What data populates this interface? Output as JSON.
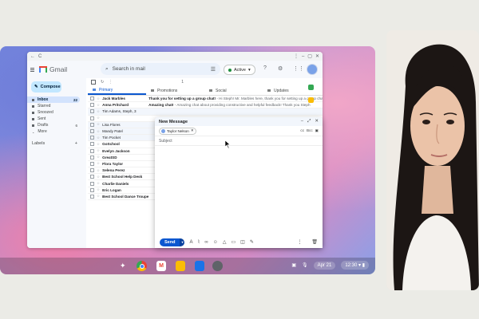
{
  "browser": {
    "nav_back": "←",
    "nav_reload": "C",
    "menu": "⋮"
  },
  "gmail": {
    "logo_text": "Gmail",
    "search_placeholder": "Search in mail",
    "status": "Active",
    "compose_label": "Compose",
    "nav": [
      {
        "label": "Inbox",
        "count": "22"
      },
      {
        "label": "Starred",
        "count": ""
      },
      {
        "label": "Snoozed",
        "count": ""
      },
      {
        "label": "Sent",
        "count": ""
      },
      {
        "label": "Drafts",
        "count": "6"
      },
      {
        "label": "More",
        "count": ""
      }
    ],
    "labels_heading": "Labels",
    "tabs": [
      "Primary",
      "Promotions",
      "Social",
      "Updates"
    ],
    "page_indicator": "1",
    "emails": [
      {
        "sender": "Jack Marbles",
        "subject": "Thank you for setting up a group chat!",
        "preview": " - Hi Steph! Mr. Marbles here, thank you for setting up a group chat",
        "read": false
      },
      {
        "sender": "Anna Pritchard",
        "subject": "Amazing chat!",
        "preview": " - Amazing chat about providing constructive and helpful feedback! Thank you Steph",
        "read": false
      },
      {
        "sender": "Tim Adams, Steph, 3",
        "subject": "",
        "preview": "",
        "read": true
      },
      {
        "sender": "",
        "subject": "",
        "preview": "",
        "read": false
      },
      {
        "sender": "Lisa Flores",
        "subject": "",
        "preview": "",
        "read": true
      },
      {
        "sender": "Mandy Patel",
        "subject": "",
        "preview": "",
        "read": true
      },
      {
        "sender": "Tim Pocket",
        "subject": "",
        "preview": "",
        "read": true
      },
      {
        "sender": "GoSchool",
        "subject": "",
        "preview": "",
        "read": false
      },
      {
        "sender": "Evelyn Jackson",
        "subject": "",
        "preview": "",
        "read": false
      },
      {
        "sender": "GreatSD",
        "subject": "",
        "preview": "",
        "read": false
      },
      {
        "sender": "Flora Taylor",
        "subject": "",
        "preview": "",
        "read": false
      },
      {
        "sender": "Selena Perez",
        "subject": "",
        "preview": "",
        "read": false
      },
      {
        "sender": "Best School Help Desk",
        "subject": "",
        "preview": "",
        "read": false
      },
      {
        "sender": "Charlie Daniels",
        "subject": "",
        "preview": "",
        "read": false
      },
      {
        "sender": "Eric Logan",
        "subject": "",
        "preview": "",
        "read": false
      },
      {
        "sender": "Best School Dance Troupe",
        "subject": "",
        "preview": "",
        "read": false
      }
    ]
  },
  "compose_window": {
    "title": "New Message",
    "recipient": "Taylor Nelson",
    "cc": "cc",
    "bcc": "Bcc",
    "subject_placeholder": "Subject",
    "send_label": "Send"
  },
  "shelf": {
    "date": "Apr 21",
    "time": "12:30"
  }
}
